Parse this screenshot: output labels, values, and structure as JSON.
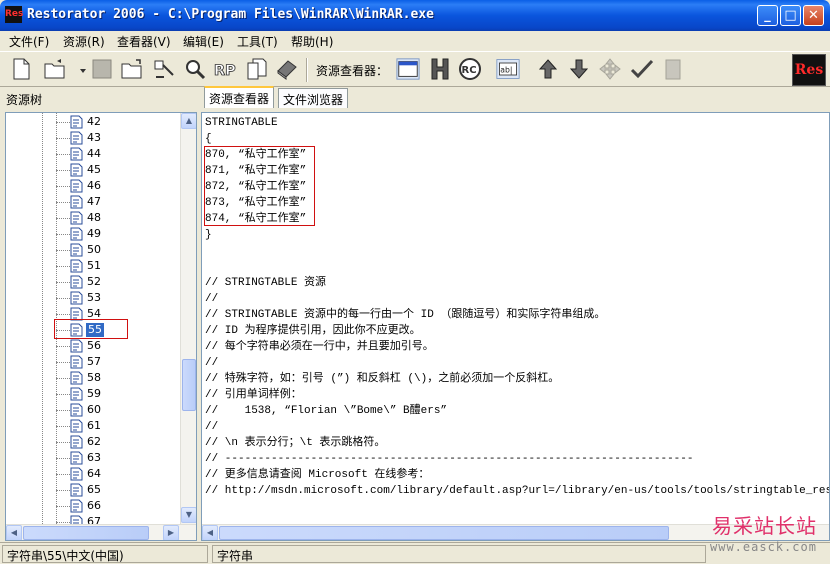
{
  "window": {
    "app_icon_text": "Res",
    "title": "Restorator 2006 - C:\\Program Files\\WinRAR\\WinRAR.exe",
    "minimize": "_",
    "maximize": "□",
    "close": "✕"
  },
  "menu": {
    "items": [
      "文件(F)",
      "资源(R)",
      "查看器(V)",
      "编辑(E)",
      "工具(T)",
      "帮助(H)"
    ]
  },
  "toolbar": {
    "viewer_label": "资源查看器：",
    "logo_text": "Res",
    "rp_label": "RP",
    "rc_label": "RC",
    "ab_label": "ab|"
  },
  "tree": {
    "title": "资源树",
    "items": [
      "42",
      "43",
      "44",
      "45",
      "46",
      "47",
      "48",
      "49",
      "50",
      "51",
      "52",
      "53",
      "54",
      "55",
      "56",
      "57",
      "58",
      "59",
      "60",
      "61",
      "62",
      "63",
      "64",
      "65",
      "66",
      "67"
    ],
    "selected": "55"
  },
  "tabs": [
    "资源查看器",
    "文件浏览器"
  ],
  "editor": {
    "lines": [
      "STRINGTABLE",
      "{",
      "870, “私守工作室”",
      "871, “私守工作室”",
      "872, “私守工作室”",
      "873, “私守工作室”",
      "874, “私守工作室”",
      "}",
      "",
      "",
      "// STRINGTABLE 资源",
      "//",
      "// STRINGTABLE 资源中的每一行由一个 ID （跟随逗号）和实际字符串组成。",
      "// ID 为程序提供引用，因此你不应更改。",
      "// 每个字符串必须在一行中，并且要加引号。",
      "//",
      "// 特殊字符，如：引号 (”) 和反斜杠 (\\)，之前必须加一个反斜杠。",
      "// 引用单词样例：",
      "//    1538, “Florian \\”Bome\\” B醴ers”",
      "//",
      "// \\n 表示分行；\\t 表示跳格符。",
      "// -----------------------------------------------------------------------",
      "// 更多信息请查阅 Microsoft 在线参考：",
      "// http://msdn.microsoft.com/library/default.asp?url=/library/en-us/tools/tools/stringtable_resource.as"
    ]
  },
  "status": {
    "left": "字符串\\55\\中文(中国)",
    "right": "字符串"
  },
  "watermark": {
    "main": "易采站长站",
    "url": "www.easck.com"
  }
}
